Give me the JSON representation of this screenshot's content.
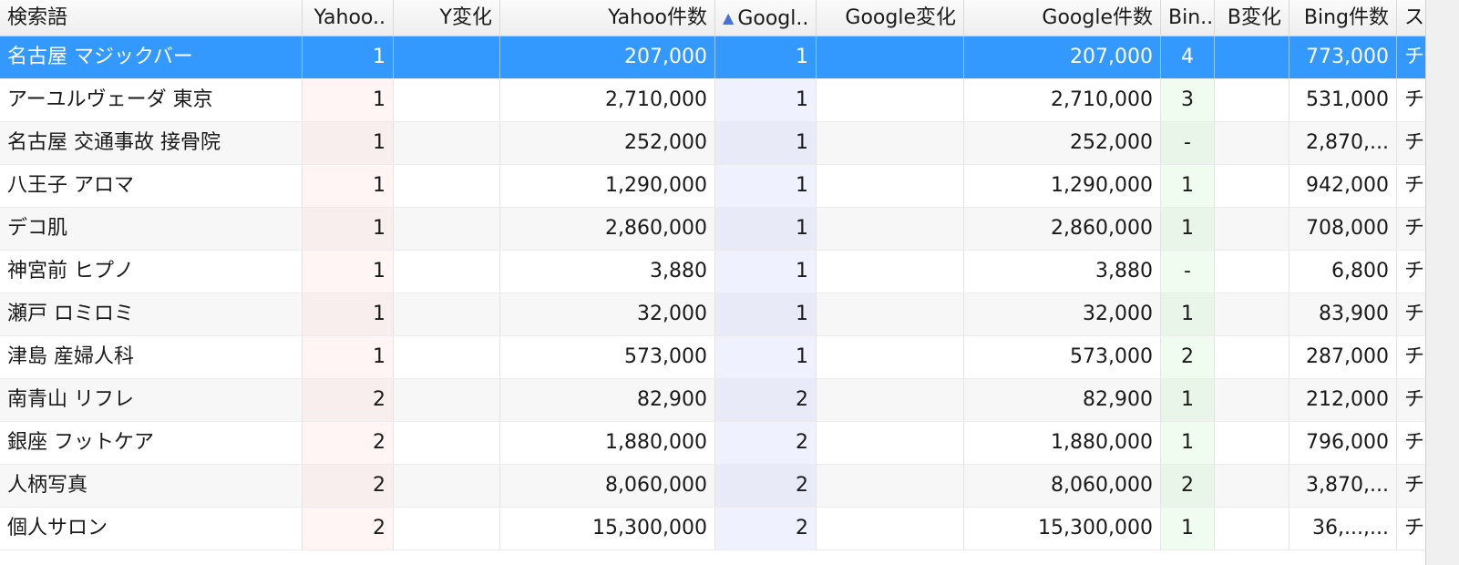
{
  "headers": {
    "term": "検索語",
    "yahoo_rank": "Yahoo..",
    "yahoo_change": "Y変化",
    "yahoo_count": "Yahoo件数",
    "google_rank": "Googl..",
    "google_change": "Google変化",
    "google_count": "Google件数",
    "bing_rank": "Bin..",
    "bing_change": "B変化",
    "bing_count": "Bing件数",
    "status": "ス"
  },
  "sort": {
    "column": "google_rank",
    "direction": "ascending",
    "arrow": "▲"
  },
  "selected_row": 0,
  "rows": [
    {
      "term": "名古屋 マジックバー",
      "yahoo_rank": "1",
      "yahoo_change": "",
      "yahoo_count": "207,000",
      "google_rank": "1",
      "google_change": "",
      "google_count": "207,000",
      "bing_rank": "4",
      "bing_change": "",
      "bing_count": "773,000",
      "status": "チ"
    },
    {
      "term": "アーユルヴェーダ 東京",
      "yahoo_rank": "1",
      "yahoo_change": "",
      "yahoo_count": "2,710,000",
      "google_rank": "1",
      "google_change": "",
      "google_count": "2,710,000",
      "bing_rank": "3",
      "bing_change": "",
      "bing_count": "531,000",
      "status": "チ"
    },
    {
      "term": "名古屋 交通事故 接骨院",
      "yahoo_rank": "1",
      "yahoo_change": "",
      "yahoo_count": "252,000",
      "google_rank": "1",
      "google_change": "",
      "google_count": "252,000",
      "bing_rank": "-",
      "bing_change": "",
      "bing_count": "2,870,...",
      "status": "チ"
    },
    {
      "term": "八王子 アロマ",
      "yahoo_rank": "1",
      "yahoo_change": "",
      "yahoo_count": "1,290,000",
      "google_rank": "1",
      "google_change": "",
      "google_count": "1,290,000",
      "bing_rank": "1",
      "bing_change": "",
      "bing_count": "942,000",
      "status": "チ"
    },
    {
      "term": "デコ肌",
      "yahoo_rank": "1",
      "yahoo_change": "",
      "yahoo_count": "2,860,000",
      "google_rank": "1",
      "google_change": "",
      "google_count": "2,860,000",
      "bing_rank": "1",
      "bing_change": "",
      "bing_count": "708,000",
      "status": "チ"
    },
    {
      "term": "神宮前 ヒプノ",
      "yahoo_rank": "1",
      "yahoo_change": "",
      "yahoo_count": "3,880",
      "google_rank": "1",
      "google_change": "",
      "google_count": "3,880",
      "bing_rank": "-",
      "bing_change": "",
      "bing_count": "6,800",
      "status": "チ"
    },
    {
      "term": "瀬戸 ロミロミ",
      "yahoo_rank": "1",
      "yahoo_change": "",
      "yahoo_count": "32,000",
      "google_rank": "1",
      "google_change": "",
      "google_count": "32,000",
      "bing_rank": "1",
      "bing_change": "",
      "bing_count": "83,900",
      "status": "チ"
    },
    {
      "term": "津島 産婦人科",
      "yahoo_rank": "1",
      "yahoo_change": "",
      "yahoo_count": "573,000",
      "google_rank": "1",
      "google_change": "",
      "google_count": "573,000",
      "bing_rank": "2",
      "bing_change": "",
      "bing_count": "287,000",
      "status": "チ"
    },
    {
      "term": "南青山 リフレ",
      "yahoo_rank": "2",
      "yahoo_change": "",
      "yahoo_count": "82,900",
      "google_rank": "2",
      "google_change": "",
      "google_count": "82,900",
      "bing_rank": "1",
      "bing_change": "",
      "bing_count": "212,000",
      "status": "チ"
    },
    {
      "term": "銀座 フットケア",
      "yahoo_rank": "2",
      "yahoo_change": "",
      "yahoo_count": "1,880,000",
      "google_rank": "2",
      "google_change": "",
      "google_count": "1,880,000",
      "bing_rank": "1",
      "bing_change": "",
      "bing_count": "796,000",
      "status": "チ"
    },
    {
      "term": "人柄写真",
      "yahoo_rank": "2",
      "yahoo_change": "",
      "yahoo_count": "8,060,000",
      "google_rank": "2",
      "google_change": "",
      "google_count": "8,060,000",
      "bing_rank": "2",
      "bing_change": "",
      "bing_count": "3,870,...",
      "status": "チ"
    },
    {
      "term": "個人サロン",
      "yahoo_rank": "2",
      "yahoo_change": "",
      "yahoo_count": "15,300,000",
      "google_rank": "2",
      "google_change": "",
      "google_count": "15,300,000",
      "bing_rank": "1",
      "bing_change": "",
      "bing_count": "36,...,...",
      "status": "チ"
    }
  ]
}
